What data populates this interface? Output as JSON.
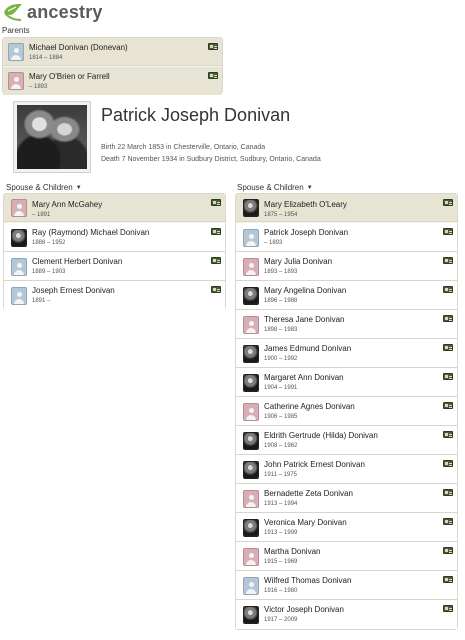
{
  "brand": {
    "name": "ancestry",
    "accent": "#7cb342"
  },
  "parents": {
    "label": "Parents",
    "people": [
      {
        "name": "Michael Donivan (Donevan)",
        "dates": "1814 – 1884",
        "gender": "m",
        "icon": "person-male-icon"
      },
      {
        "name": "Mary O'Brien or Farrell",
        "dates": "– 1893",
        "gender": "f",
        "icon": "person-female-icon"
      }
    ]
  },
  "focus": {
    "name": "Patrick Joseph Donivan",
    "birth": "Birth 22 March 1853 in Chesterville, Ontario, Canada",
    "death": "Death 7 November 1934 in Sudbury District, Sudbury, Ontario, Canada"
  },
  "spouse_left": {
    "label": "Spouse & Children",
    "spouse": {
      "name": "Mary Ann McGahey",
      "dates": "– 1891",
      "gender": "f"
    },
    "children": [
      {
        "name": "Ray (Raymond) Michael Donivan",
        "dates": "1888 – 1952",
        "gender": "photo"
      },
      {
        "name": "Clement Herbert Donivan",
        "dates": "1889 – 1903",
        "gender": "m"
      },
      {
        "name": "Joseph Ernest Donivan",
        "dates": "1891 –",
        "gender": "m"
      }
    ]
  },
  "spouse_right": {
    "label": "Spouse & Children",
    "spouse": {
      "name": "Mary Elizabeth O'Leary",
      "dates": "1875 – 1954",
      "gender": "photo"
    },
    "children": [
      {
        "name": "Patrick Joseph Donivan",
        "dates": "– 1893",
        "gender": "m"
      },
      {
        "name": "Mary Julia Donivan",
        "dates": "1893 – 1893",
        "gender": "f"
      },
      {
        "name": "Mary Angelina Donivan",
        "dates": "1896 – 1988",
        "gender": "photo"
      },
      {
        "name": "Theresa Jane Donivan",
        "dates": "1898 – 1983",
        "gender": "f"
      },
      {
        "name": "James Edmund Donivan",
        "dates": "1900 – 1992",
        "gender": "photo"
      },
      {
        "name": "Margaret Ann Donivan",
        "dates": "1904 – 1991",
        "gender": "photo"
      },
      {
        "name": "Catherine Agnes Donivan",
        "dates": "1906 – 1985",
        "gender": "f"
      },
      {
        "name": "Eldrith Gertrude (Hilda) Donivan",
        "dates": "1908 – 1962",
        "gender": "photo"
      },
      {
        "name": "John Patrick Ernest Donivan",
        "dates": "1911 – 1975",
        "gender": "photo"
      },
      {
        "name": "Bernadette Zeta Donivan",
        "dates": "1913 – 1994",
        "gender": "f"
      },
      {
        "name": "Veronica Mary Donivan",
        "dates": "1913 – 1999",
        "gender": "photo"
      },
      {
        "name": "Martha Donivan",
        "dates": "1915 – 1969",
        "gender": "f"
      },
      {
        "name": "Wilfred Thomas Donivan",
        "dates": "1916 – 1980",
        "gender": "m"
      },
      {
        "name": "Victor Joseph Donivan",
        "dates": "1917 – 2009",
        "gender": "photo"
      }
    ]
  }
}
